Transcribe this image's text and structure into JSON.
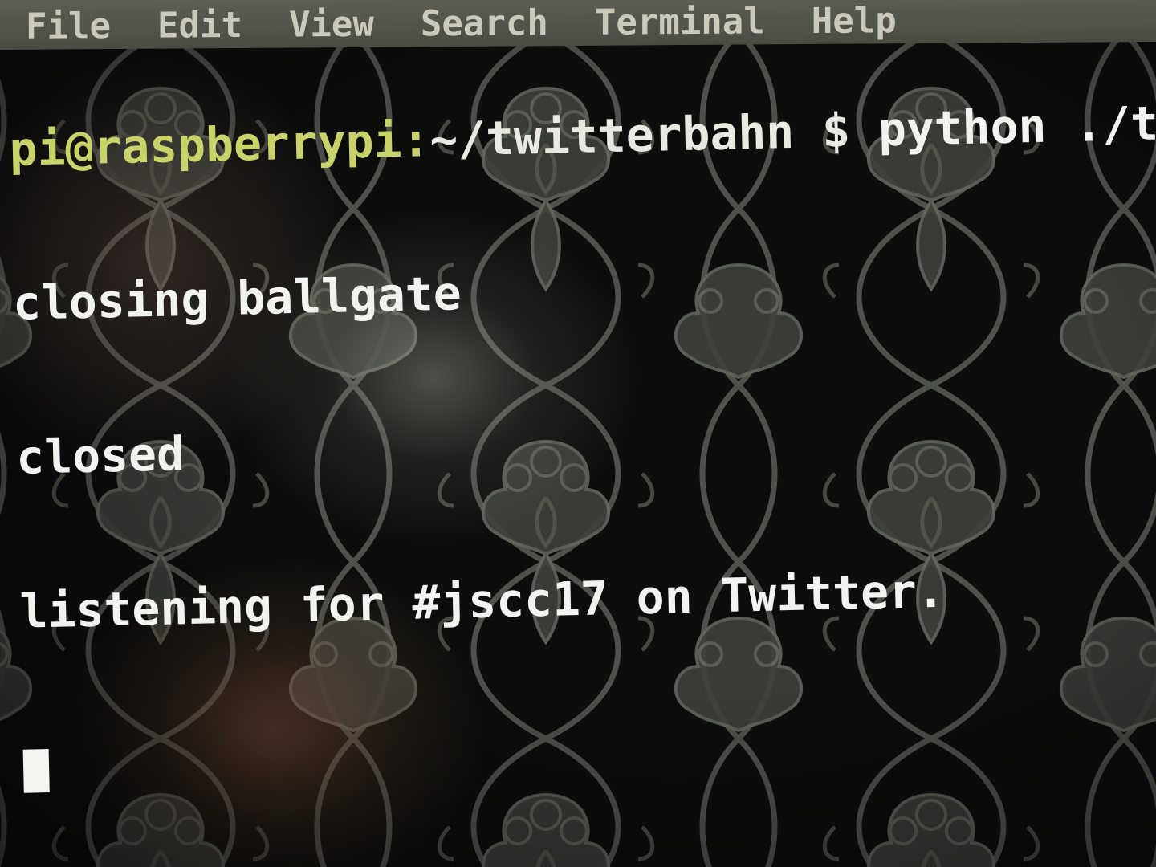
{
  "menubar": {
    "items": [
      "File",
      "Edit",
      "View",
      "Search",
      "Terminal",
      "Help"
    ]
  },
  "terminal": {
    "prompt_user": "pi@raspberrypi",
    "prompt_sep": ":",
    "prompt_path": "~/twitterbahn $",
    "command": "python ./twitte",
    "output": [
      "closing ballgate",
      "closed",
      "listening for #jscc17 on Twitter."
    ]
  },
  "colors": {
    "prompt": "#c9d36a",
    "text": "#f2f2ee",
    "background": "#0a0b0a"
  }
}
